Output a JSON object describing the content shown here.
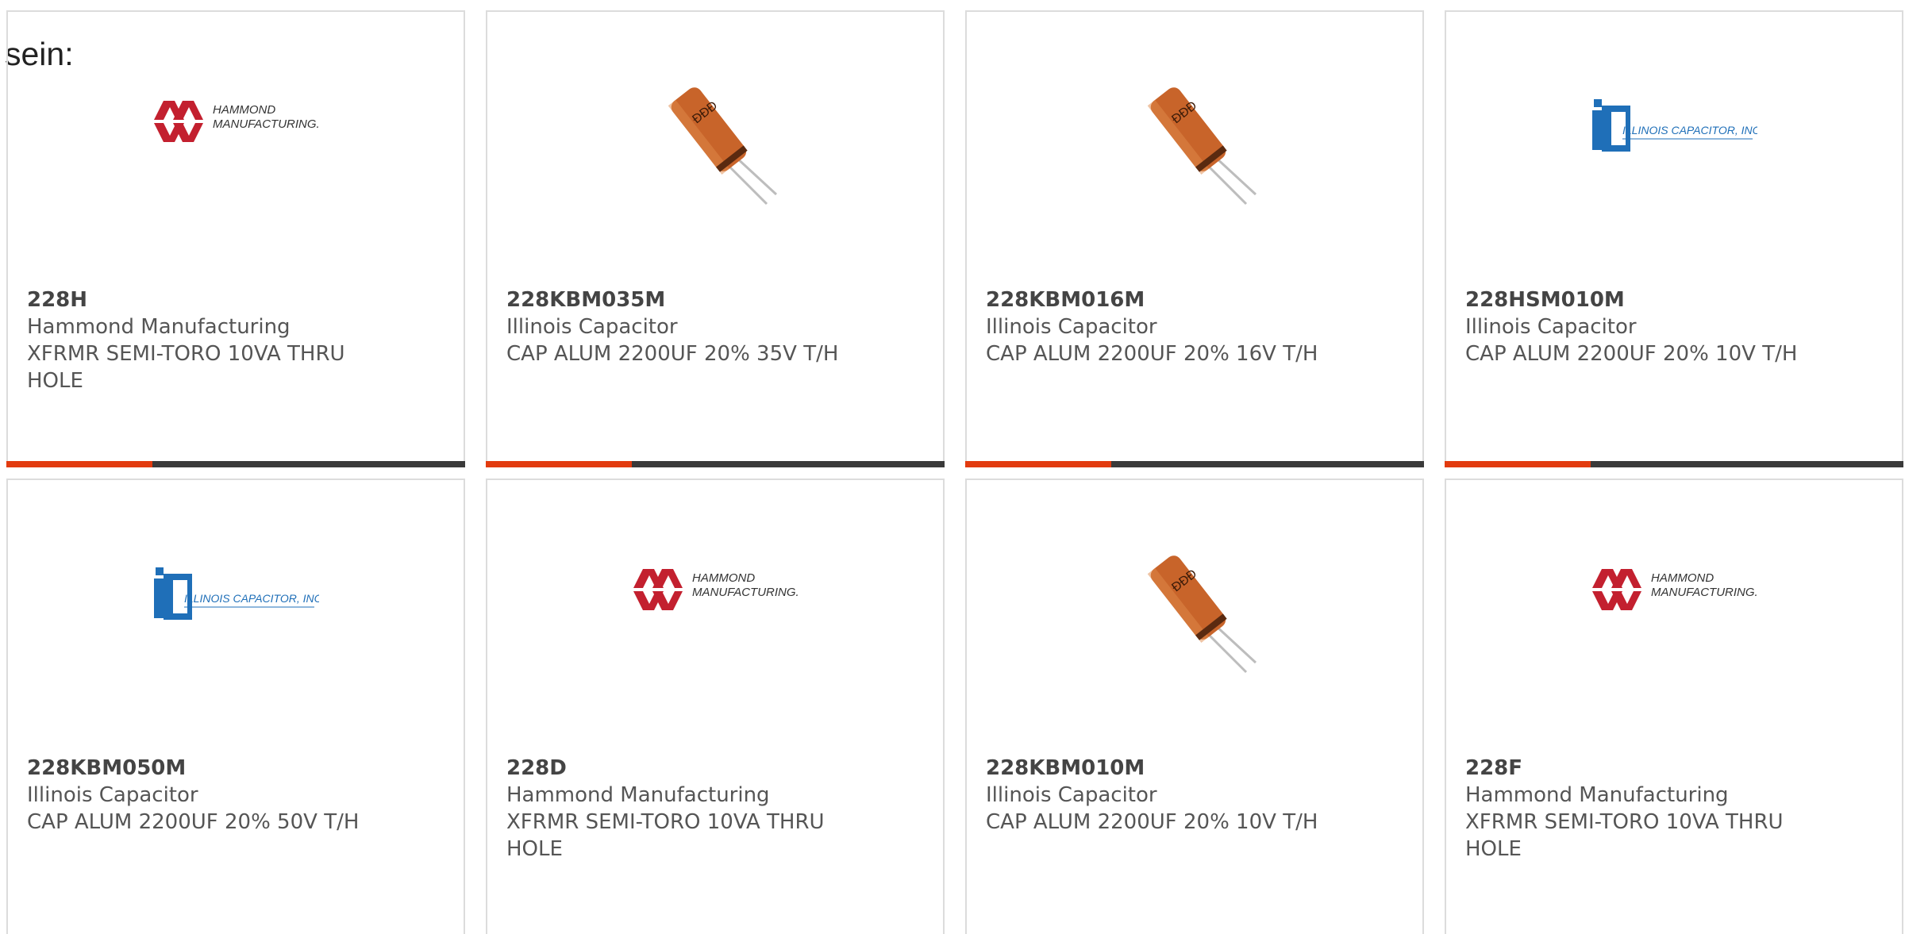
{
  "intro": "sein:",
  "colors": {
    "accent": "#e23b0f",
    "bar": "#3a3a3a",
    "hammond_red": "#c3202f",
    "illinois_blue": "#1f6fb8",
    "capacitor_orange": "#c8642a"
  },
  "cards": [
    {
      "part": "228H",
      "manufacturer": "Hammond Manufacturing",
      "description": "XFRMR SEMI-TORO 10VA THRU HOLE",
      "image": "hammond-logo"
    },
    {
      "part": "228KBM035M",
      "manufacturer": "Illinois Capacitor",
      "description": "CAP ALUM 2200UF 20% 35V T/H",
      "image": "capacitor-photo"
    },
    {
      "part": "228KBM016M",
      "manufacturer": "Illinois Capacitor",
      "description": "CAP ALUM 2200UF 20% 16V T/H",
      "image": "capacitor-photo"
    },
    {
      "part": "228HSM010M",
      "manufacturer": "Illinois Capacitor",
      "description": "CAP ALUM 2200UF 20% 10V T/H",
      "image": "illinois-capacitor-logo"
    },
    {
      "part": "228KBM050M",
      "manufacturer": "Illinois Capacitor",
      "description": "CAP ALUM 2200UF 20% 50V T/H",
      "image": "illinois-capacitor-logo"
    },
    {
      "part": "228D",
      "manufacturer": "Hammond Manufacturing",
      "description": "XFRMR SEMI-TORO 10VA THRU HOLE",
      "image": "hammond-logo"
    },
    {
      "part": "228KBM010M",
      "manufacturer": "Illinois Capacitor",
      "description": "CAP ALUM 2200UF 20% 10V T/H",
      "image": "capacitor-photo"
    },
    {
      "part": "228F",
      "manufacturer": "Hammond Manufacturing",
      "description": "XFRMR SEMI-TORO 10VA THRU HOLE",
      "image": "hammond-logo"
    }
  ],
  "logos": {
    "hammond_line1": "HAMMOND",
    "hammond_line2": "MANUFACTURING.",
    "illinois_text": "ILLINOIS CAPACITOR, INC."
  }
}
